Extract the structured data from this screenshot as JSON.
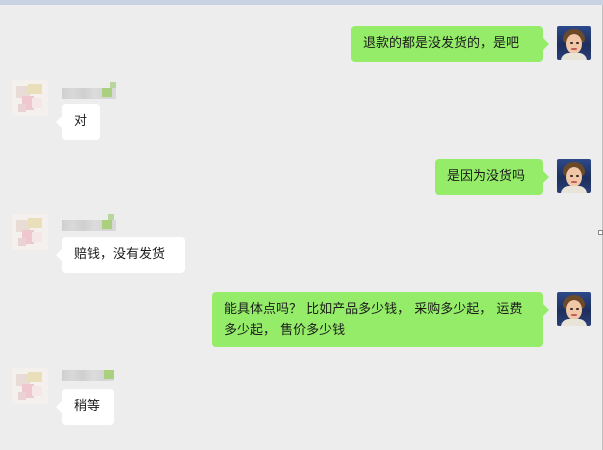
{
  "colors": {
    "background": "#ededed",
    "my_bubble": "#95ec69",
    "other_bubble": "#ffffff",
    "text": "#1a1a1a"
  },
  "messages": [
    {
      "sender": "me",
      "text": "退款的都是没发货的，是吧"
    },
    {
      "sender": "other",
      "text": "对"
    },
    {
      "sender": "me",
      "text": "是因为没货吗"
    },
    {
      "sender": "other",
      "text": "赔钱，没有发货"
    },
    {
      "sender": "me",
      "text": "能具体点吗？ 比如产品多少钱， 采购多少起， 运费多少起， 售价多少钱"
    },
    {
      "sender": "other",
      "text": "稍等"
    }
  ]
}
